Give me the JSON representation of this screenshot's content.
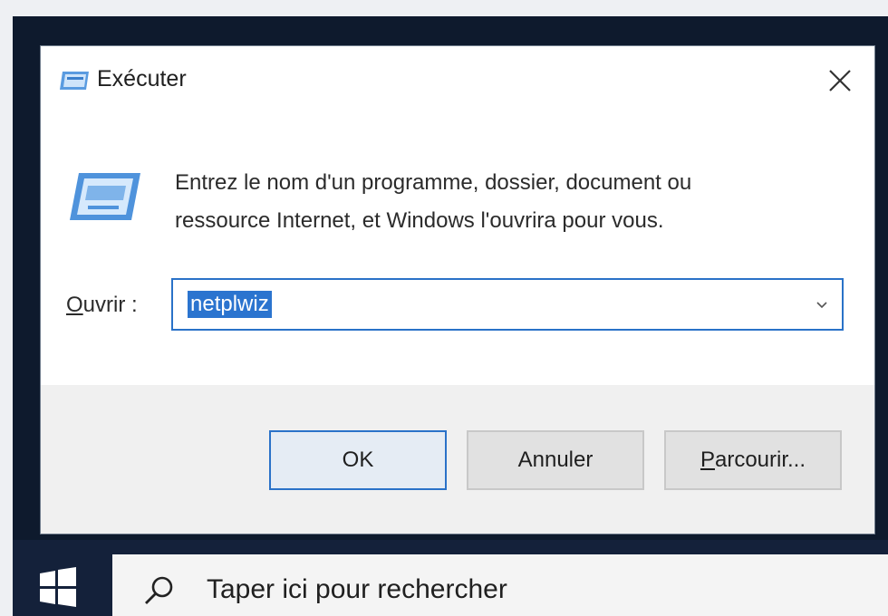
{
  "dialog": {
    "title": "Exécuter",
    "description_line1": "Entrez le nom d'un programme, dossier, document ou",
    "description_line2": "ressource Internet, et Windows l'ouvrira pour vous.",
    "open_label_accel": "O",
    "open_label_rest": "uvrir :",
    "input_value": "netplwiz",
    "buttons": {
      "ok": "OK",
      "cancel": "Annuler",
      "browse_accel": "P",
      "browse_rest": "arcourir..."
    }
  },
  "taskbar": {
    "search_placeholder": "Taper ici pour rechercher"
  },
  "icons": {
    "title": "run-icon",
    "app": "run-program-icon",
    "close": "close-icon",
    "dropdown": "chevron-down-icon",
    "start": "windows-logo-icon",
    "search": "search-icon"
  },
  "colors": {
    "accent": "#2a72c8",
    "selection": "#2b74cf",
    "taskbar": "#14213a"
  }
}
